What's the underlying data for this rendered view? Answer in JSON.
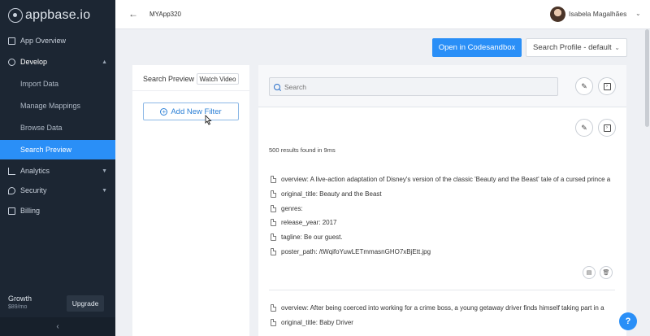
{
  "sidebar": {
    "logo_text": "appbase.io",
    "items": [
      {
        "label": "App Overview"
      },
      {
        "label": "Develop"
      },
      {
        "label": "Analytics"
      },
      {
        "label": "Security"
      },
      {
        "label": "Billing"
      }
    ],
    "sub_items": [
      {
        "label": "Import Data"
      },
      {
        "label": "Manage Mappings"
      },
      {
        "label": "Browse Data"
      },
      {
        "label": "Search Preview",
        "active": true
      }
    ],
    "plan": {
      "name": "Growth",
      "price": "$89/mo",
      "upgrade_label": "Upgrade"
    },
    "collapse_icon": "chevron-left"
  },
  "topbar": {
    "app_name": "MYApp320",
    "user_name": "Isabela Magalhães"
  },
  "actions": {
    "codesandbox_label": "Open in Codesandbox",
    "profile_label": "Search Profile - default"
  },
  "filters": {
    "title": "Search Preview",
    "watch_video_label": "Watch Video",
    "add_filter_label": "Add New Filter"
  },
  "results": {
    "search_placeholder": "Search",
    "count_text": "500 results found in 9ms",
    "items": [
      {
        "fields": [
          "overview: A live-action adaptation of Disney's version of the classic 'Beauty and the Beast' tale of a cursed prince a",
          "original_title: Beauty and the Beast",
          "genres:",
          "release_year: 2017",
          "tagline: Be our guest.",
          "poster_path: /tWqifoYuwLETmmasnGHO7xBjEtt.jpg"
        ]
      },
      {
        "fields": [
          "overview: After being coerced into working for a crime boss, a young getaway driver finds himself taking part in a",
          "original_title: Baby Driver"
        ]
      }
    ]
  },
  "colors": {
    "accent": "#2a8ff7",
    "sidebar_bg": "#1c2633"
  }
}
